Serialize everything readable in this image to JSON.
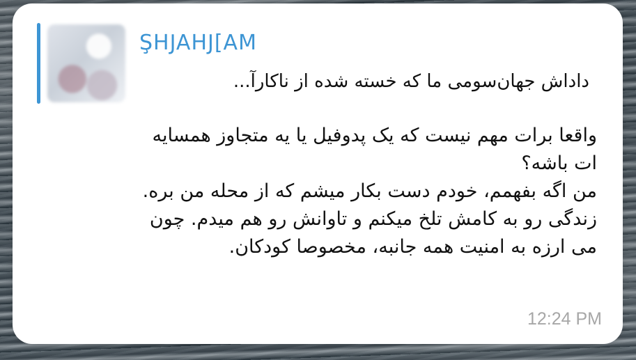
{
  "reply": {
    "author": "ŞHJAHJ[AM",
    "preview": "داداش جهان‌سومی ما که خسته شده از ناکارآ..."
  },
  "message": {
    "lines": [
      "واقعا برات مهم نیست که یک پدوفیل یا یه متجاوز همسایه",
      "ات باشه؟",
      "من اگه بفهمم، خودم دست بکار میشم که از محله من بره.",
      "زندگی رو به کامش تلخ میکنم و تاوانش رو هم میدم. چون",
      "می ارزه به امنیت همه جانبه، مخصوصا کودکان."
    ],
    "time": "12:24 PM"
  },
  "colors": {
    "accent": "#3d95d4",
    "bubble": "#ffffff",
    "text": "#111111",
    "time": "#a7a7a7"
  }
}
